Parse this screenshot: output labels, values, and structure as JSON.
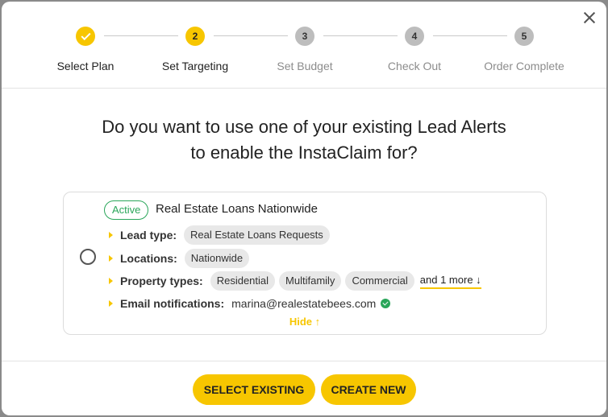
{
  "steps": [
    {
      "number": "1",
      "label": "Select Plan",
      "state": "done"
    },
    {
      "number": "2",
      "label": "Set Targeting",
      "state": "current"
    },
    {
      "number": "3",
      "label": "Set Budget",
      "state": "todo"
    },
    {
      "number": "4",
      "label": "Check Out",
      "state": "todo"
    },
    {
      "number": "5",
      "label": "Order Complete",
      "state": "todo"
    }
  ],
  "question": {
    "line1": "Do you want to use one of your existing Lead Alerts",
    "line2": "to enable the InstaClaim for?"
  },
  "alert": {
    "status": "Active",
    "name": "Real Estate Loans Nationwide",
    "lead_type_label": "Lead type:",
    "lead_type": "Real Estate Loans Requests",
    "locations_label": "Locations:",
    "locations": "Nationwide",
    "property_types_label": "Property types:",
    "property_types": [
      "Residential",
      "Multifamily",
      "Commercial"
    ],
    "more_link": "and 1 more ↓",
    "email_label": "Email notifications:",
    "email": "marina@realestatebees.com",
    "hide_link": "Hide ↑"
  },
  "buttons": {
    "select_existing": "SELECT EXISTING",
    "create_new": "CREATE NEW"
  },
  "colors": {
    "accent": "#f7c600",
    "success": "#2aa65a",
    "inactive_step": "#bdbdbd"
  }
}
